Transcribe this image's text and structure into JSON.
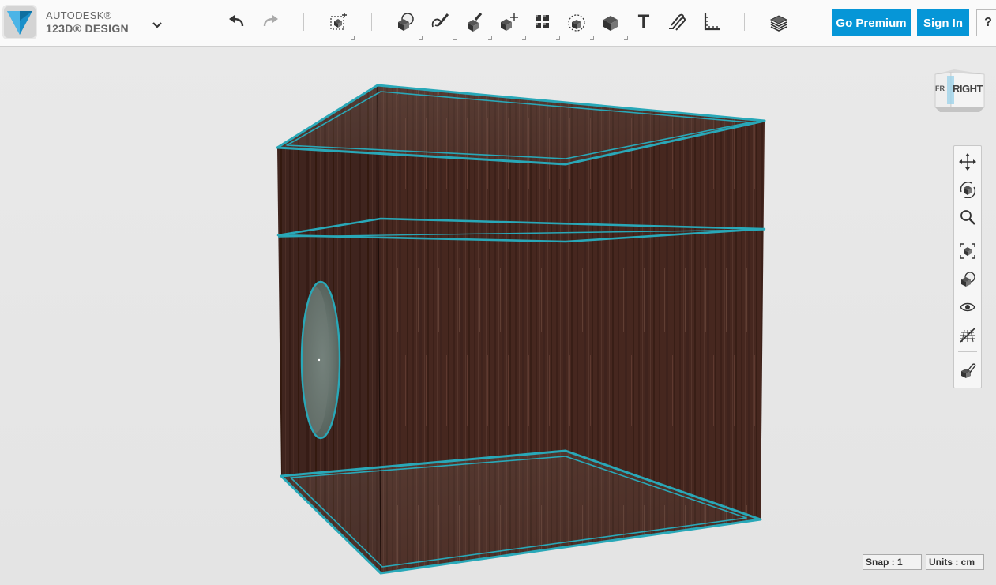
{
  "app": {
    "brand_top": "AUTODESK®",
    "brand_bottom": "123D® DESIGN",
    "logo_color": "#1a8fc9"
  },
  "toolbar": {
    "tools": [
      {
        "name": "undo-icon"
      },
      {
        "name": "redo-icon"
      },
      {
        "name": "transform-icon"
      },
      {
        "name": "primitives-icon"
      },
      {
        "name": "sketch-icon"
      },
      {
        "name": "construct-icon"
      },
      {
        "name": "modify-icon"
      },
      {
        "name": "pattern-icon"
      },
      {
        "name": "group-icon"
      },
      {
        "name": "combine-icon"
      },
      {
        "name": "text-icon",
        "glyph": "T"
      },
      {
        "name": "snap-icon"
      },
      {
        "name": "measure-icon"
      },
      {
        "name": "material-icon"
      }
    ],
    "go_premium_label": "Go Premium",
    "sign_in_label": "Sign In",
    "help_label": "?",
    "accent_color": "#0696d7"
  },
  "view_cube": {
    "face_right": "RIGHT",
    "face_front": "FRONT"
  },
  "nav_tools": [
    {
      "name": "pan-icon"
    },
    {
      "name": "orbit-icon"
    },
    {
      "name": "zoom-icon"
    },
    {
      "name": "fit-view-icon"
    },
    {
      "name": "shaded-view-icon"
    },
    {
      "name": "visibility-icon"
    },
    {
      "name": "grid-toggle-icon"
    },
    {
      "name": "material-mode-icon"
    }
  ],
  "status": {
    "snap": "Snap : 1",
    "units": "Units : cm"
  },
  "scene": {
    "object": "wooden-box",
    "edge_highlight_color": "#29a8b8",
    "wood_color": "#4a2a22"
  }
}
